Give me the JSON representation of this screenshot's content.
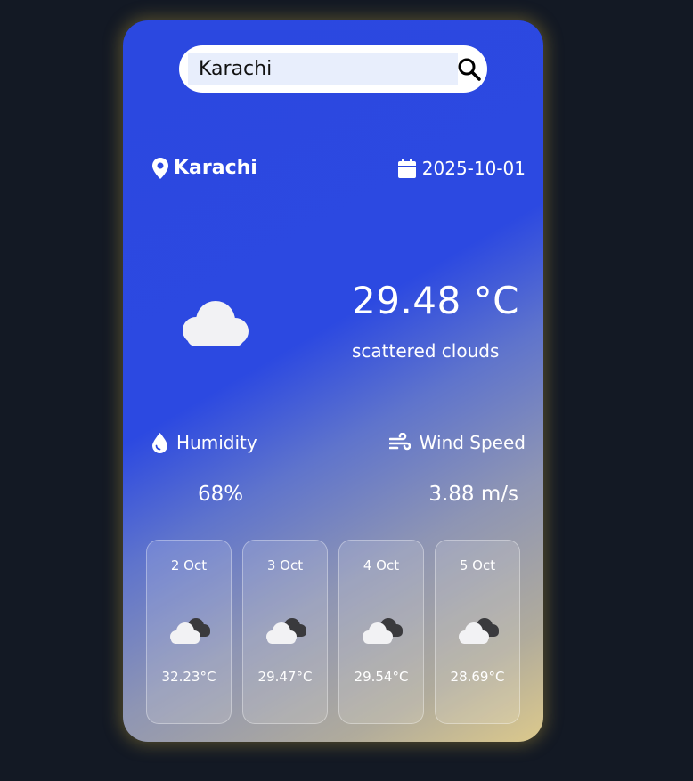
{
  "search": {
    "value": "Karachi"
  },
  "location": {
    "city": "Karachi",
    "date": "2025-10-01"
  },
  "current": {
    "temperature": "29.48 °C",
    "condition": "scattered clouds",
    "humidity_label": "Humidity",
    "humidity_value": "68%",
    "wind_label": "Wind Speed",
    "wind_value": "3.88 m/s"
  },
  "forecast": [
    {
      "date": "2 Oct",
      "temp": "32.23°C",
      "icon": "broken-clouds-icon"
    },
    {
      "date": "3 Oct",
      "temp": "29.47°C",
      "icon": "broken-clouds-icon"
    },
    {
      "date": "4 Oct",
      "temp": "29.54°C",
      "icon": "broken-clouds-icon"
    },
    {
      "date": "5 Oct",
      "temp": "28.69°C",
      "icon": "broken-clouds-icon"
    }
  ],
  "colors": {
    "page_background": "#131924",
    "card_gradient_start": "#2b48e0",
    "card_gradient_end": "#dcc98c"
  }
}
